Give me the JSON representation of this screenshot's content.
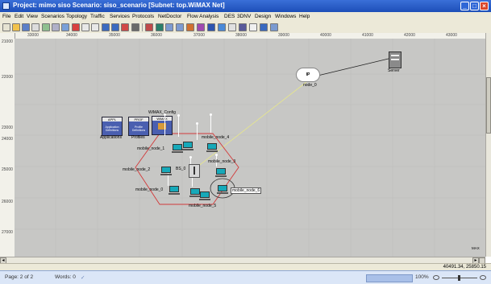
{
  "window": {
    "title": "Project: mimo siso Scenario: siso_scenario [Subnet: top.WiMAX Net]",
    "controls": [
      "_",
      "□",
      "×"
    ]
  },
  "menu": [
    "File",
    "Edit",
    "View",
    "Scenarios",
    "Topology",
    "Traffic",
    "Services",
    "Protocols",
    "NetDoctor",
    "Flow Analysis",
    "DES",
    "3DNV",
    "Design",
    "Windows",
    "Help"
  ],
  "ruler": {
    "x_ticks": [
      "33000",
      "34000",
      "35000",
      "36000",
      "37000",
      "38000",
      "39000",
      "40000",
      "41000",
      "42000",
      "43000"
    ],
    "y_ticks": [
      "21000",
      "22000",
      "23000",
      "24000",
      "25000",
      "26000",
      "27000"
    ]
  },
  "canvas": {
    "config_objects": [
      {
        "label": "Application\nDefinitions",
        "caption": "Applications",
        "tag": "APPL"
      },
      {
        "label": "Profile\nDefinitions",
        "caption": "Profiles",
        "tag": "PROF"
      },
      {
        "label": "WiMAX_Config",
        "caption": "",
        "tag": "WiMAX"
      }
    ],
    "ip_cloud": {
      "label": "IP",
      "caption": "node_0"
    },
    "server": {
      "caption": "Server"
    },
    "base_station": {
      "caption": "BS_0"
    },
    "mobiles": [
      "mobile_node_1",
      "mobile_node_4",
      "mobile_node_2",
      "mobile_node_3",
      "mobile_node_0",
      "mobile_node_5",
      "mobile_node_6"
    ],
    "corner_tag": "MAX"
  },
  "coords": "40491.34, 25850.15",
  "status": {
    "page": "Page: 2 of 2",
    "words": "Words: 0",
    "zoom": "100%"
  }
}
